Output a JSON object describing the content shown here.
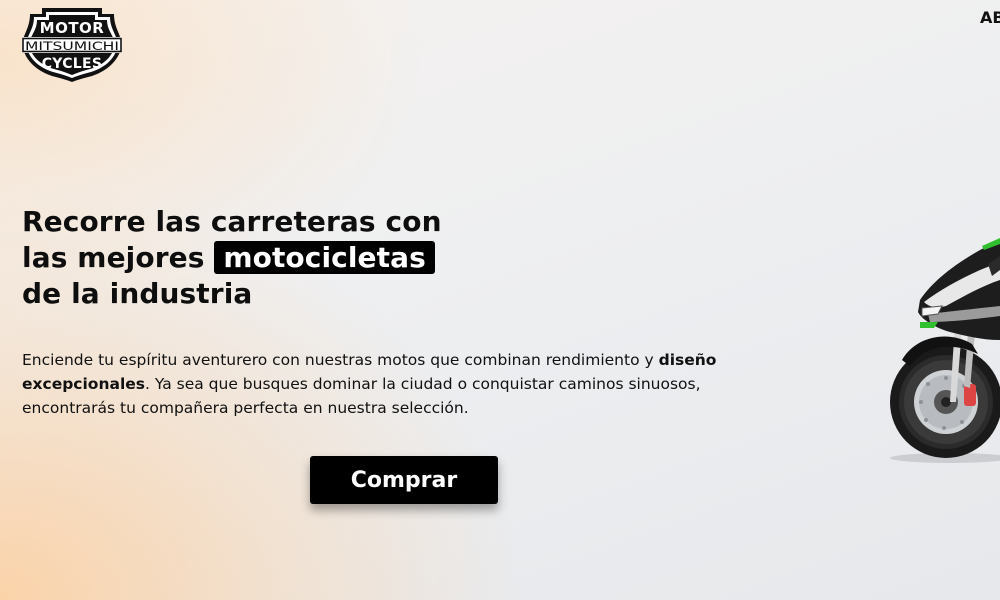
{
  "header": {
    "logo": {
      "icon": "motor-cycles-shield-logo",
      "top_text": "MOTOR",
      "middle_text": "MITSUMICHI",
      "bottom_text": "CYCLES"
    },
    "nav_partial": "AB"
  },
  "hero": {
    "title_line1": "Recorre las carreteras con",
    "title_line2_before": "las mejores ",
    "title_highlight": "motocicletas",
    "title_line3": "de la industria",
    "desc_line1_before": "Enciende tu espíritu aventurero con nuestras motos que combinan rendimiento y ",
    "desc_bold_1": "diseño",
    "desc_bold_2": "excepcionales",
    "desc_line2_after": ". Ya sea que busques dominar la ciudad o conquistar caminos sinuosos,",
    "desc_line3": "encontrarás tu compañera perfecta en nuestra selección.",
    "cta_label": "Comprar",
    "image_icon": "motorcycle-image"
  },
  "colors": {
    "accent": "#000000",
    "highlight_text": "#ffffff",
    "background_warm": "#fdce9c",
    "background_cool": "#e6e8eb",
    "bike_accent": "#2fbf2f"
  }
}
